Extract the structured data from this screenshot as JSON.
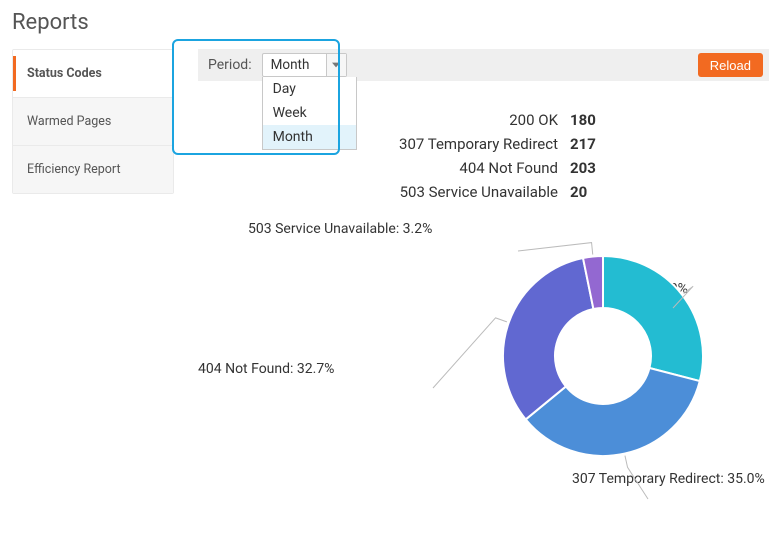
{
  "title": "Reports",
  "sidebar": {
    "items": [
      {
        "label": "Status Codes",
        "active": true
      },
      {
        "label": "Warmed Pages",
        "active": false
      },
      {
        "label": "Efficiency Report",
        "active": false
      }
    ]
  },
  "toolbar": {
    "period_label": "Period:",
    "selected_value": "Month",
    "options": [
      "Day",
      "Week",
      "Month"
    ],
    "highlighted_option_index": 2,
    "reload_label": "Reload"
  },
  "stats": [
    {
      "label": "200 OK",
      "value": "180"
    },
    {
      "label": "307 Temporary Redirect",
      "value": "217"
    },
    {
      "label": "404 Not Found",
      "value": "203"
    },
    {
      "label": "503 Service Unavailable",
      "value": "20"
    }
  ],
  "chart_data": {
    "type": "pie",
    "title": "",
    "series": [
      {
        "name": "200 OK",
        "value": 29.0,
        "color": "#23bcd2"
      },
      {
        "name": "307 Temporary Redirect",
        "value": 35.0,
        "color": "#4c8ed8"
      },
      {
        "name": "404 Not Found",
        "value": 32.7,
        "color": "#6168d1"
      },
      {
        "name": "503 Service Unavailable",
        "value": 3.2,
        "color": "#9368d1"
      }
    ],
    "donut_inner_ratio": 0.48,
    "start_angle_deg": -90
  },
  "chart_labels": {
    "top": "503 Service Unavailable: 3.2%",
    "right": "200 OK: 29.0%",
    "bottom": "307 Temporary Redirect: 35.0%",
    "left": "404 Not Found: 32.7%"
  }
}
